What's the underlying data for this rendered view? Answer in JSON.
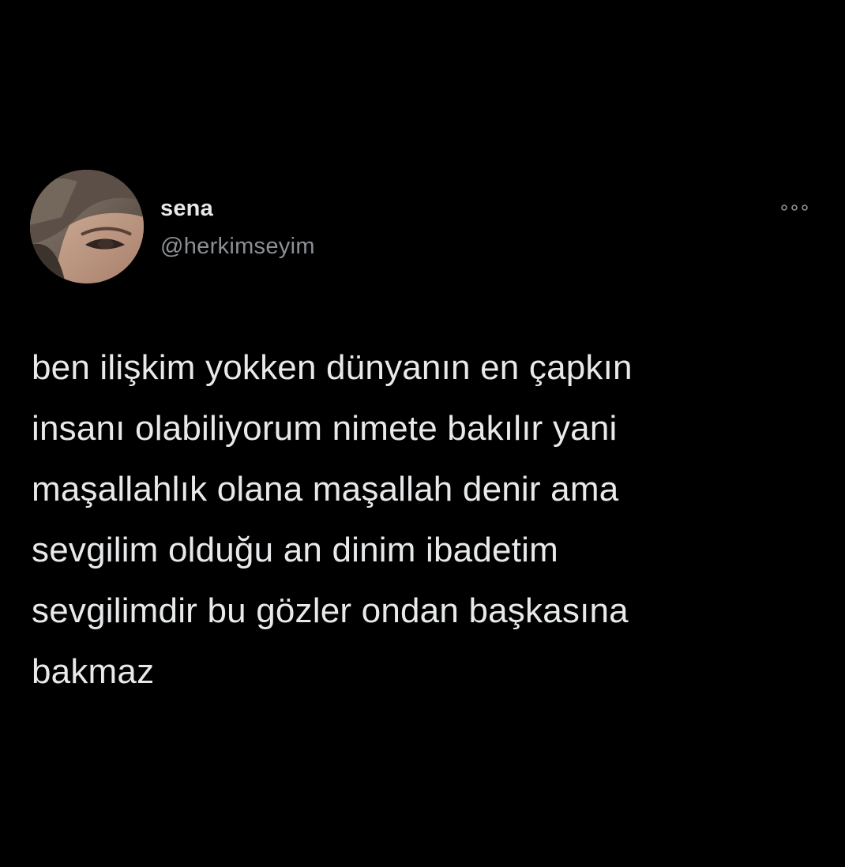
{
  "tweet": {
    "author": {
      "name": "sena",
      "handle": "@herkimseyim",
      "avatar": "profile-photo"
    },
    "more_icon": "more-horizontal-icon",
    "text_lines": [
      "ben ilişkim yokken dünyanın en çapkın",
      "insanı olabiliyorum nimete bakılır yani",
      "maşallahlık olana maşallah denir ama",
      "sevgilim olduğu an dinim ibadetim",
      "sevgilimdir bu gözler ondan başkasına",
      "bakmaz"
    ]
  },
  "colors": {
    "background": "#000000",
    "text_primary": "#e7e9ea",
    "text_secondary": "#8b9096"
  }
}
